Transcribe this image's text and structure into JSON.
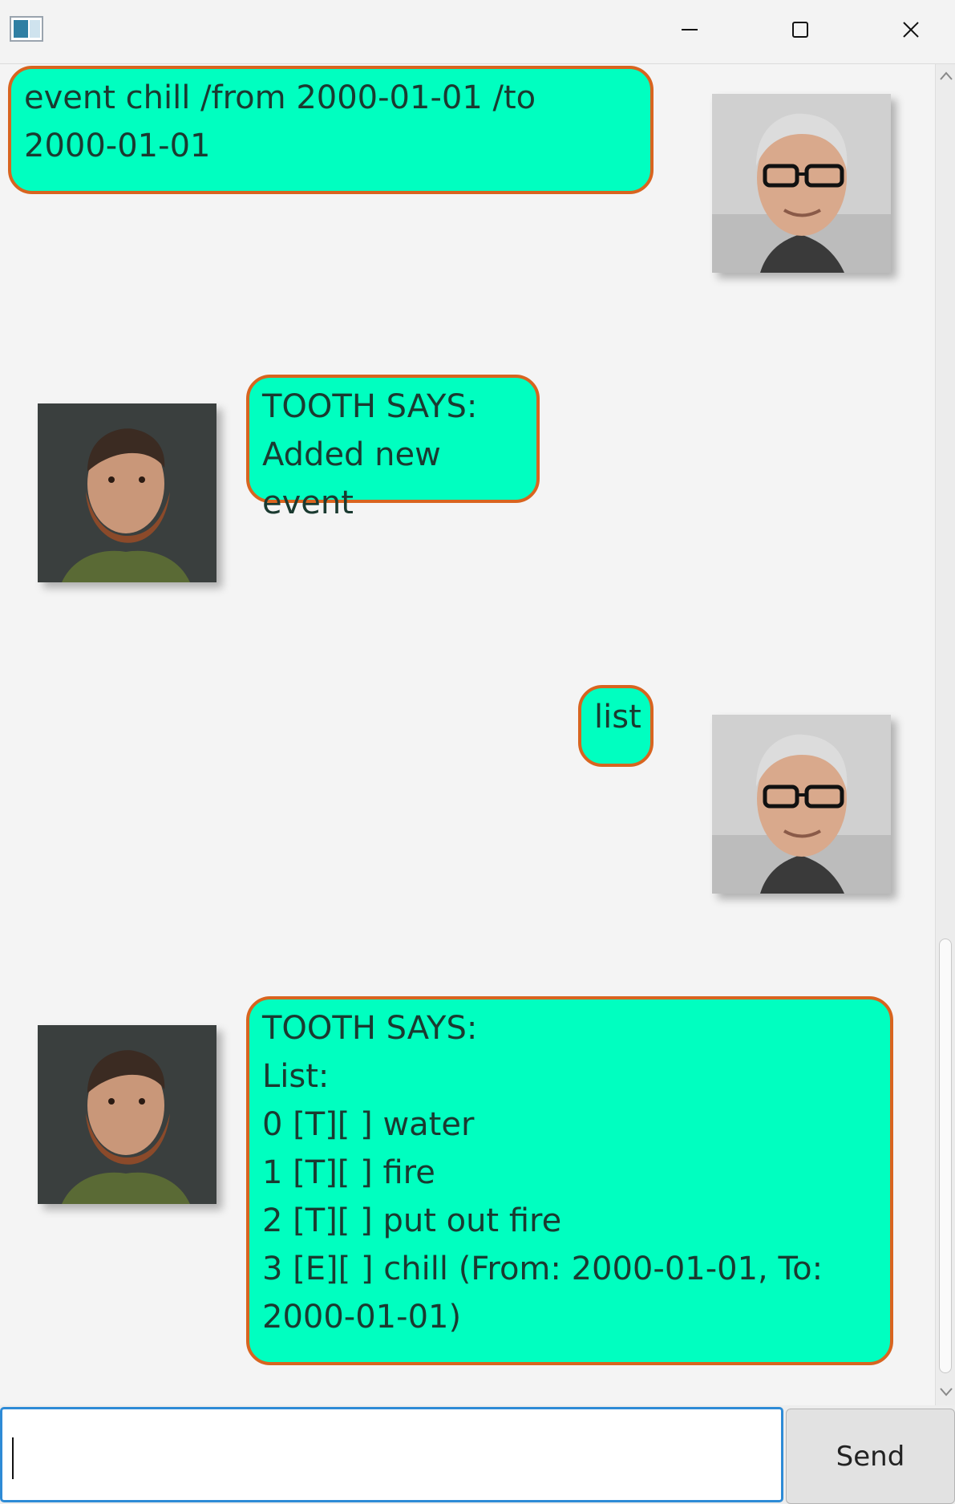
{
  "window": {
    "controls": [
      "minimize-icon",
      "maximize-icon",
      "close-icon"
    ]
  },
  "messages": [
    {
      "sender": "user",
      "text": "event chill /from 2000-01-01 /to\n2000-01-01"
    },
    {
      "sender": "bot",
      "text": "TOOTH SAYS:\nAdded new event"
    },
    {
      "sender": "user",
      "text": "list"
    },
    {
      "sender": "bot",
      "text": "TOOTH SAYS:\nList:\n0 [T][ ] water\n1 [T][ ] fire\n2 [T][ ] put out fire\n3 [E][ ] chill (From: 2000-01-01, To:\n2000-01-01)"
    }
  ],
  "input": {
    "value": "",
    "placeholder": ""
  },
  "send_button": {
    "label": "Send"
  },
  "colors": {
    "bubble_fill": "#00ffc0",
    "bubble_border": "#d8641f",
    "background": "#f4f4f4"
  }
}
